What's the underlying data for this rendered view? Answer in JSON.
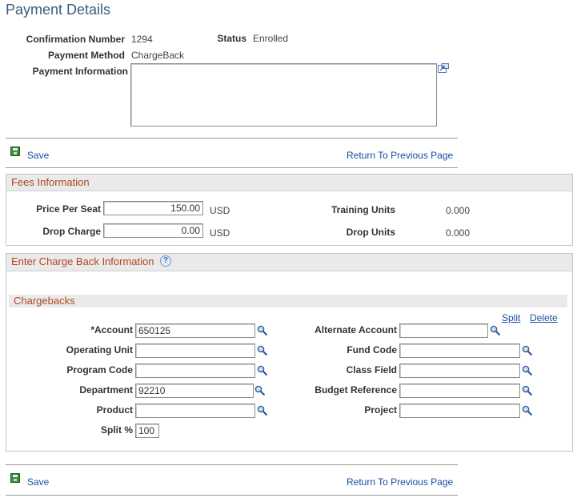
{
  "page_title": "Payment Details",
  "header": {
    "confirmation_label": "Confirmation Number",
    "confirmation_value": "1294",
    "status_label": "Status",
    "status_value": "Enrolled",
    "payment_method_label": "Payment Method",
    "payment_method_value": "ChargeBack",
    "payment_info_label": "Payment Information",
    "payment_info_value": ""
  },
  "toolbar": {
    "save_label": "Save",
    "return_label": "Return To Previous Page"
  },
  "fees": {
    "title": "Fees Information",
    "price_label": "Price Per Seat",
    "price_value": "150.00",
    "price_currency": "USD",
    "drop_label": "Drop Charge",
    "drop_value": "0.00",
    "drop_currency": "USD",
    "training_units_label": "Training Units",
    "training_units_value": "0.000",
    "drop_units_label": "Drop Units",
    "drop_units_value": "0.000"
  },
  "chargeback": {
    "title": "Enter Charge Back Information",
    "help_glyph": "?",
    "sub_title": "Chargebacks",
    "split_link": "Split",
    "delete_link": "Delete",
    "account_label": "*Account",
    "account_value": "650125",
    "alternate_account_label": "Alternate Account",
    "alternate_account_value": "",
    "operating_unit_label": "Operating Unit",
    "operating_unit_value": "",
    "fund_code_label": "Fund Code",
    "fund_code_value": "",
    "program_code_label": "Program Code",
    "program_code_value": "",
    "class_field_label": "Class Field",
    "class_field_value": "",
    "department_label": "Department",
    "department_value": "92210",
    "budget_reference_label": "Budget Reference",
    "budget_reference_value": "",
    "product_label": "Product",
    "product_value": "",
    "project_label": "Project",
    "project_value": "",
    "split_pct_label": "Split %",
    "split_pct_value": "100"
  },
  "icons": {
    "save": "save-icon",
    "expand": "expand-icon",
    "lookup": "lookup-icon",
    "help": "help-icon"
  },
  "colors": {
    "title": "#3d5a80",
    "section_header_text": "#b0471f",
    "link": "#1a4ea0",
    "section_header_bg": "#eaeaea"
  }
}
